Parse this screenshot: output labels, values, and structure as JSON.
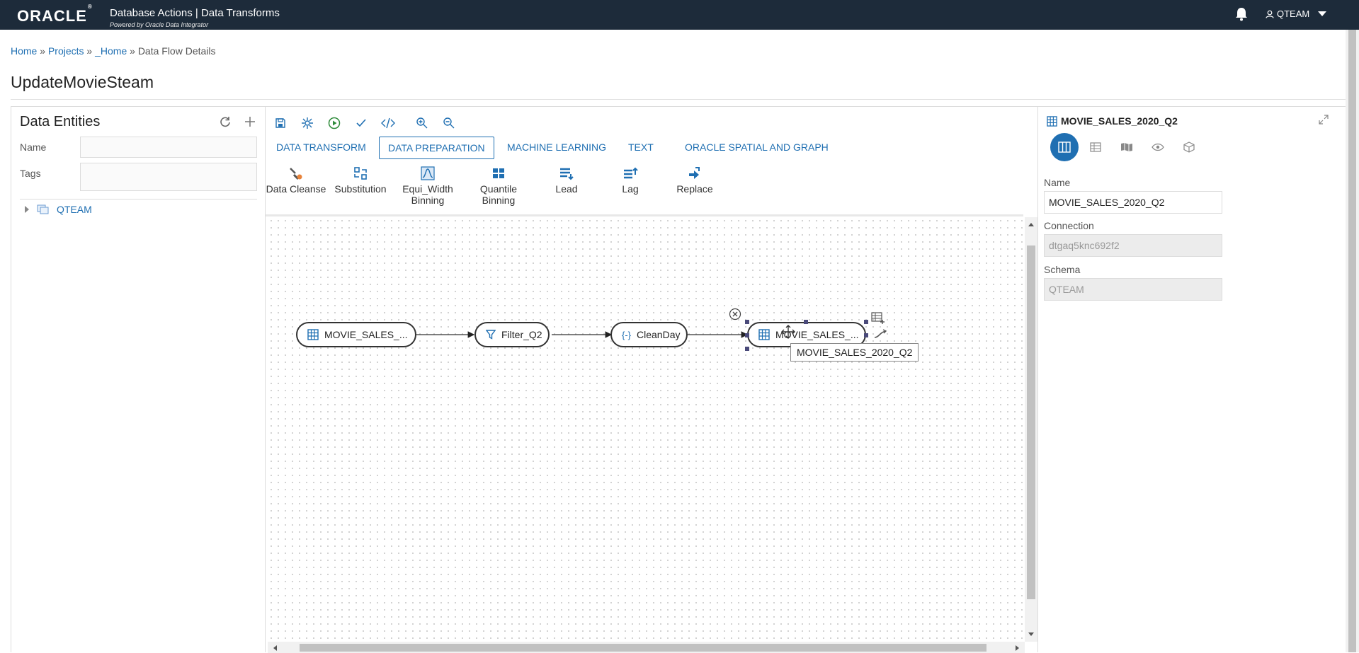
{
  "header": {
    "logo": "ORACLE",
    "logo_mark": "®",
    "app_title": "Database Actions | Data Transforms",
    "app_subtitle": "Powered by Oracle Data Integrator",
    "user": "QTEAM"
  },
  "breadcrumb": {
    "items": [
      "Home",
      "Projects",
      "_Home"
    ],
    "separator": "»",
    "current": "Data Flow Details"
  },
  "page_title": "UpdateMovieSteam",
  "data_entities": {
    "title": "Data Entities",
    "name_label": "Name",
    "name_value": "",
    "tags_label": "Tags",
    "tags_value": "",
    "tree_items": [
      "QTEAM"
    ]
  },
  "tabs": [
    "DATA TRANSFORM",
    "DATA PREPARATION",
    "MACHINE LEARNING",
    "TEXT",
    "ORACLE SPATIAL AND GRAPH"
  ],
  "active_tab": "DATA PREPARATION",
  "tools": [
    {
      "label_line1": "Data Cleanse",
      "label_line2": ""
    },
    {
      "label_line1": "Substitution",
      "label_line2": ""
    },
    {
      "label_line1": "Equi_Width",
      "label_line2": "Binning"
    },
    {
      "label_line1": "Quantile",
      "label_line2": "Binning"
    },
    {
      "label_line1": "Lead",
      "label_line2": ""
    },
    {
      "label_line1": "Lag",
      "label_line2": ""
    },
    {
      "label_line1": "Replace",
      "label_line2": ""
    }
  ],
  "flow": {
    "nodes": [
      "MOVIE_SALES_...",
      "Filter_Q2",
      "CleanDay",
      "MOVIE_SALES_..."
    ],
    "tooltip": "MOVIE_SALES_2020_Q2"
  },
  "properties": {
    "title": "MOVIE_SALES_2020_Q2",
    "name_label": "Name",
    "name_value": "MOVIE_SALES_2020_Q2",
    "connection_label": "Connection",
    "connection_value": "dtgaq5knc692f2",
    "schema_label": "Schema",
    "schema_value": "QTEAM"
  },
  "colors": {
    "header_bg": "#1d2b3a",
    "link": "#1f6fb2",
    "active_icon_bg": "#1f6fb2"
  }
}
